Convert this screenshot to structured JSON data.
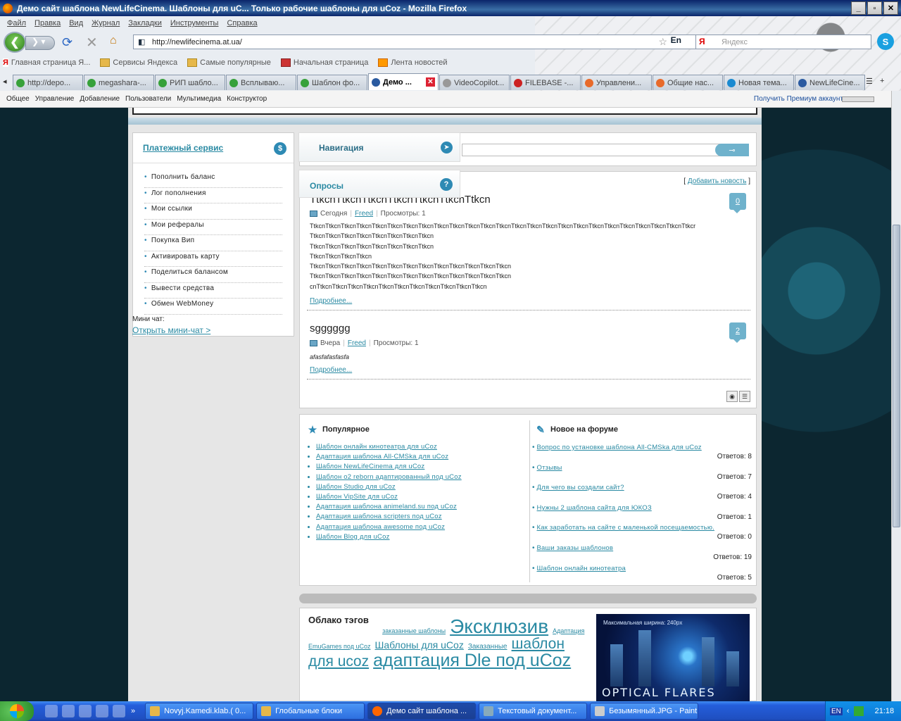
{
  "window": {
    "title": "Демо сайт шаблона NewLifeCinema. Шаблоны для uC... Только рабочие шаблоны для uCoz - Mozilla Firefox"
  },
  "menu": [
    "Файл",
    "Правка",
    "Вид",
    "Журнал",
    "Закладки",
    "Инструменты",
    "Справка"
  ],
  "navbar": {
    "url": "http://newlifecinema.at.ua/",
    "lang": "En",
    "search_placeholder": "Яндекс",
    "search_engine_icon": "Я",
    "skype_label": "S"
  },
  "bookmarks": [
    "Главная страница Я...",
    "Сервисы Яндекса",
    "Самые популярные",
    "Начальная страница",
    "Лента новостей"
  ],
  "tabs": [
    {
      "label": "http://depo...",
      "active": false
    },
    {
      "label": "megashara-...",
      "active": false
    },
    {
      "label": "РИП шабло...",
      "active": false
    },
    {
      "label": "Всплываю...",
      "active": false
    },
    {
      "label": "Шаблон фо...",
      "active": false
    },
    {
      "label": "Демо ...",
      "active": true
    },
    {
      "label": "VideoCopilot...",
      "active": false
    },
    {
      "label": "FILEBASE -...",
      "active": false
    },
    {
      "label": "Управлени...",
      "active": false
    },
    {
      "label": "Общие нас...",
      "active": false
    },
    {
      "label": "Новая тема...",
      "active": false
    },
    {
      "label": "NewLifeCine...",
      "active": false
    }
  ],
  "ucozbar": {
    "items": [
      "Общее",
      "Управление",
      "Добавление",
      "Пользователи",
      "Мультимедиа",
      "Конструктор"
    ],
    "premium": "Получить Премиум аккаунт"
  },
  "sidebar": {
    "title": "Платежный сервис",
    "icon": "$",
    "items": [
      "Пополнить баланс",
      "Лог пополнения",
      "Мои ссылки",
      "Мои рефералы",
      "Покупка Вип",
      "Активировать карту",
      "Поделиться балансом",
      "Вывести средства",
      "Обмен WebMoney"
    ],
    "minichat_label": "Мини чат:",
    "minichat_link": "Открыть мини-чат >"
  },
  "panels": {
    "navigation": "Навигация",
    "polls": "Опросы",
    "polls_icon": "?"
  },
  "news": {
    "add_prefix": "[ ",
    "add_link": "Добавить новость",
    "add_suffix": " ]",
    "entries": [
      {
        "title": "TtkcnTtkcnTtkcnTtkcnTtkcnTtkcnTtkcn",
        "date": "Сегодня",
        "author": "Freed",
        "views": "Просмотры: 1",
        "comments": "0",
        "body": [
          "TtkcnTtkcnTtkcnTtkcnTtkcnTtkcnTtkcnTtkcnTtkcnTtkcnTtkcnTtkcnTtkcnTtkcnTtkcnTtkcnTtkcnTtkcnTtkcnTtkcnTtkcnTtkcnTtkcnTtkcnTtkcr",
          "TtkcnTtkcnTtkcnTtkcnTtkcnTtkcnTtkcnTtkcn",
          "TtkcnTtkcnTtkcnTtkcnTtkcnTtkcnTtkcnTtkcn",
          "TtkcnTtkcnTtkcnTtkcn",
          "TtkcnTtkcnTtkcnTtkcnTtkcnTtkcnTtkcnTtkcnTtkcnTtkcnTtkcnTtkcnTtkcn",
          "TtkcnTtkcnTtkcnTtkcnTtkcnTtkcnTtkcnTtkcnTtkcnTtkcnTtkcnTtkcnTtkcn",
          "cnTtkcnTtkcnTtkcnTtkcnTtkcnTtkcnTtkcnTtkcnTtkcnTtkcnTtkcn"
        ],
        "more": "Подробнее..."
      },
      {
        "title": "sgggggg",
        "date": "Вчера",
        "author": "Freed",
        "views": "Просмотры: 1",
        "comments": "2",
        "body": [
          "afasfafasfasfa"
        ],
        "more": "Подробнее..."
      }
    ]
  },
  "popular": {
    "title": "Популярное",
    "items": [
      "Шаблон онлайн кинотеатра для uCoz",
      "Адаптация шаблона All-CMSka для uCoz",
      "Шаблон NewLifeCinema для uCoz",
      "Шаблон o2 reborn адаптированный под uCoz",
      "Шаблон Studio для uCoz",
      "Шаблон VipSite для uCoz",
      "Адаптация шаблона animeland.su под uCoz",
      "Адаптация шаблона scripters под uCoz",
      "Адаптация шаблона awesome под uCoz",
      "Шаблон Blog для uCoz"
    ]
  },
  "forum": {
    "title": "Новое на форуме",
    "items": [
      {
        "title": "Вопрос по установке шаблона All-CMSka для uCoz",
        "replies": "Ответов: 8"
      },
      {
        "title": "Отзывы",
        "replies": "Ответов: 7"
      },
      {
        "title": "Для чего вы создали сайт?",
        "replies": "Ответов: 4"
      },
      {
        "title": "Нужны 2 шаблона сайта для ЮКОЗ",
        "replies": "Ответов: 1"
      },
      {
        "title": "Как заработать на сайте с маленькой посещаемостью.",
        "replies": "Ответов: 0"
      },
      {
        "title": "Ваши заказы шаблонов",
        "replies": "Ответов: 19"
      },
      {
        "title": "Шаблон онлайн кинотеатра",
        "replies": "Ответов: 5"
      }
    ]
  },
  "tagcloud": {
    "title": "Облако тэгов",
    "tags": [
      {
        "text": "заказанные шаблоны",
        "size": 9
      },
      {
        "text": "Эксклюзив",
        "size": 28
      },
      {
        "text": "Адаптация EmuGames под uCoz",
        "size": 9
      },
      {
        "text": "Шаблоны для uCoz",
        "size": 14
      },
      {
        "text": "Заказанные",
        "size": 10
      },
      {
        "text": "шаблон для ucoz",
        "size": 21
      },
      {
        "text": "адаптация Dle под uCoz",
        "size": 25
      }
    ]
  },
  "banner": {
    "top": "Максимальная ширина: 240px",
    "title": "OPTICAL FLARES"
  },
  "taskbar": {
    "tasks": [
      {
        "label": "Novyj.Kamedi.klab.( 0...",
        "active": false
      },
      {
        "label": "Глобальные блоки",
        "active": false
      },
      {
        "label": "Демо сайт шаблона ...",
        "active": true
      },
      {
        "label": "Текстовый документ...",
        "active": false
      },
      {
        "label": "Безымянный.JPG - Paint",
        "active": false
      }
    ],
    "lang": "EN",
    "clock": "21:18"
  }
}
